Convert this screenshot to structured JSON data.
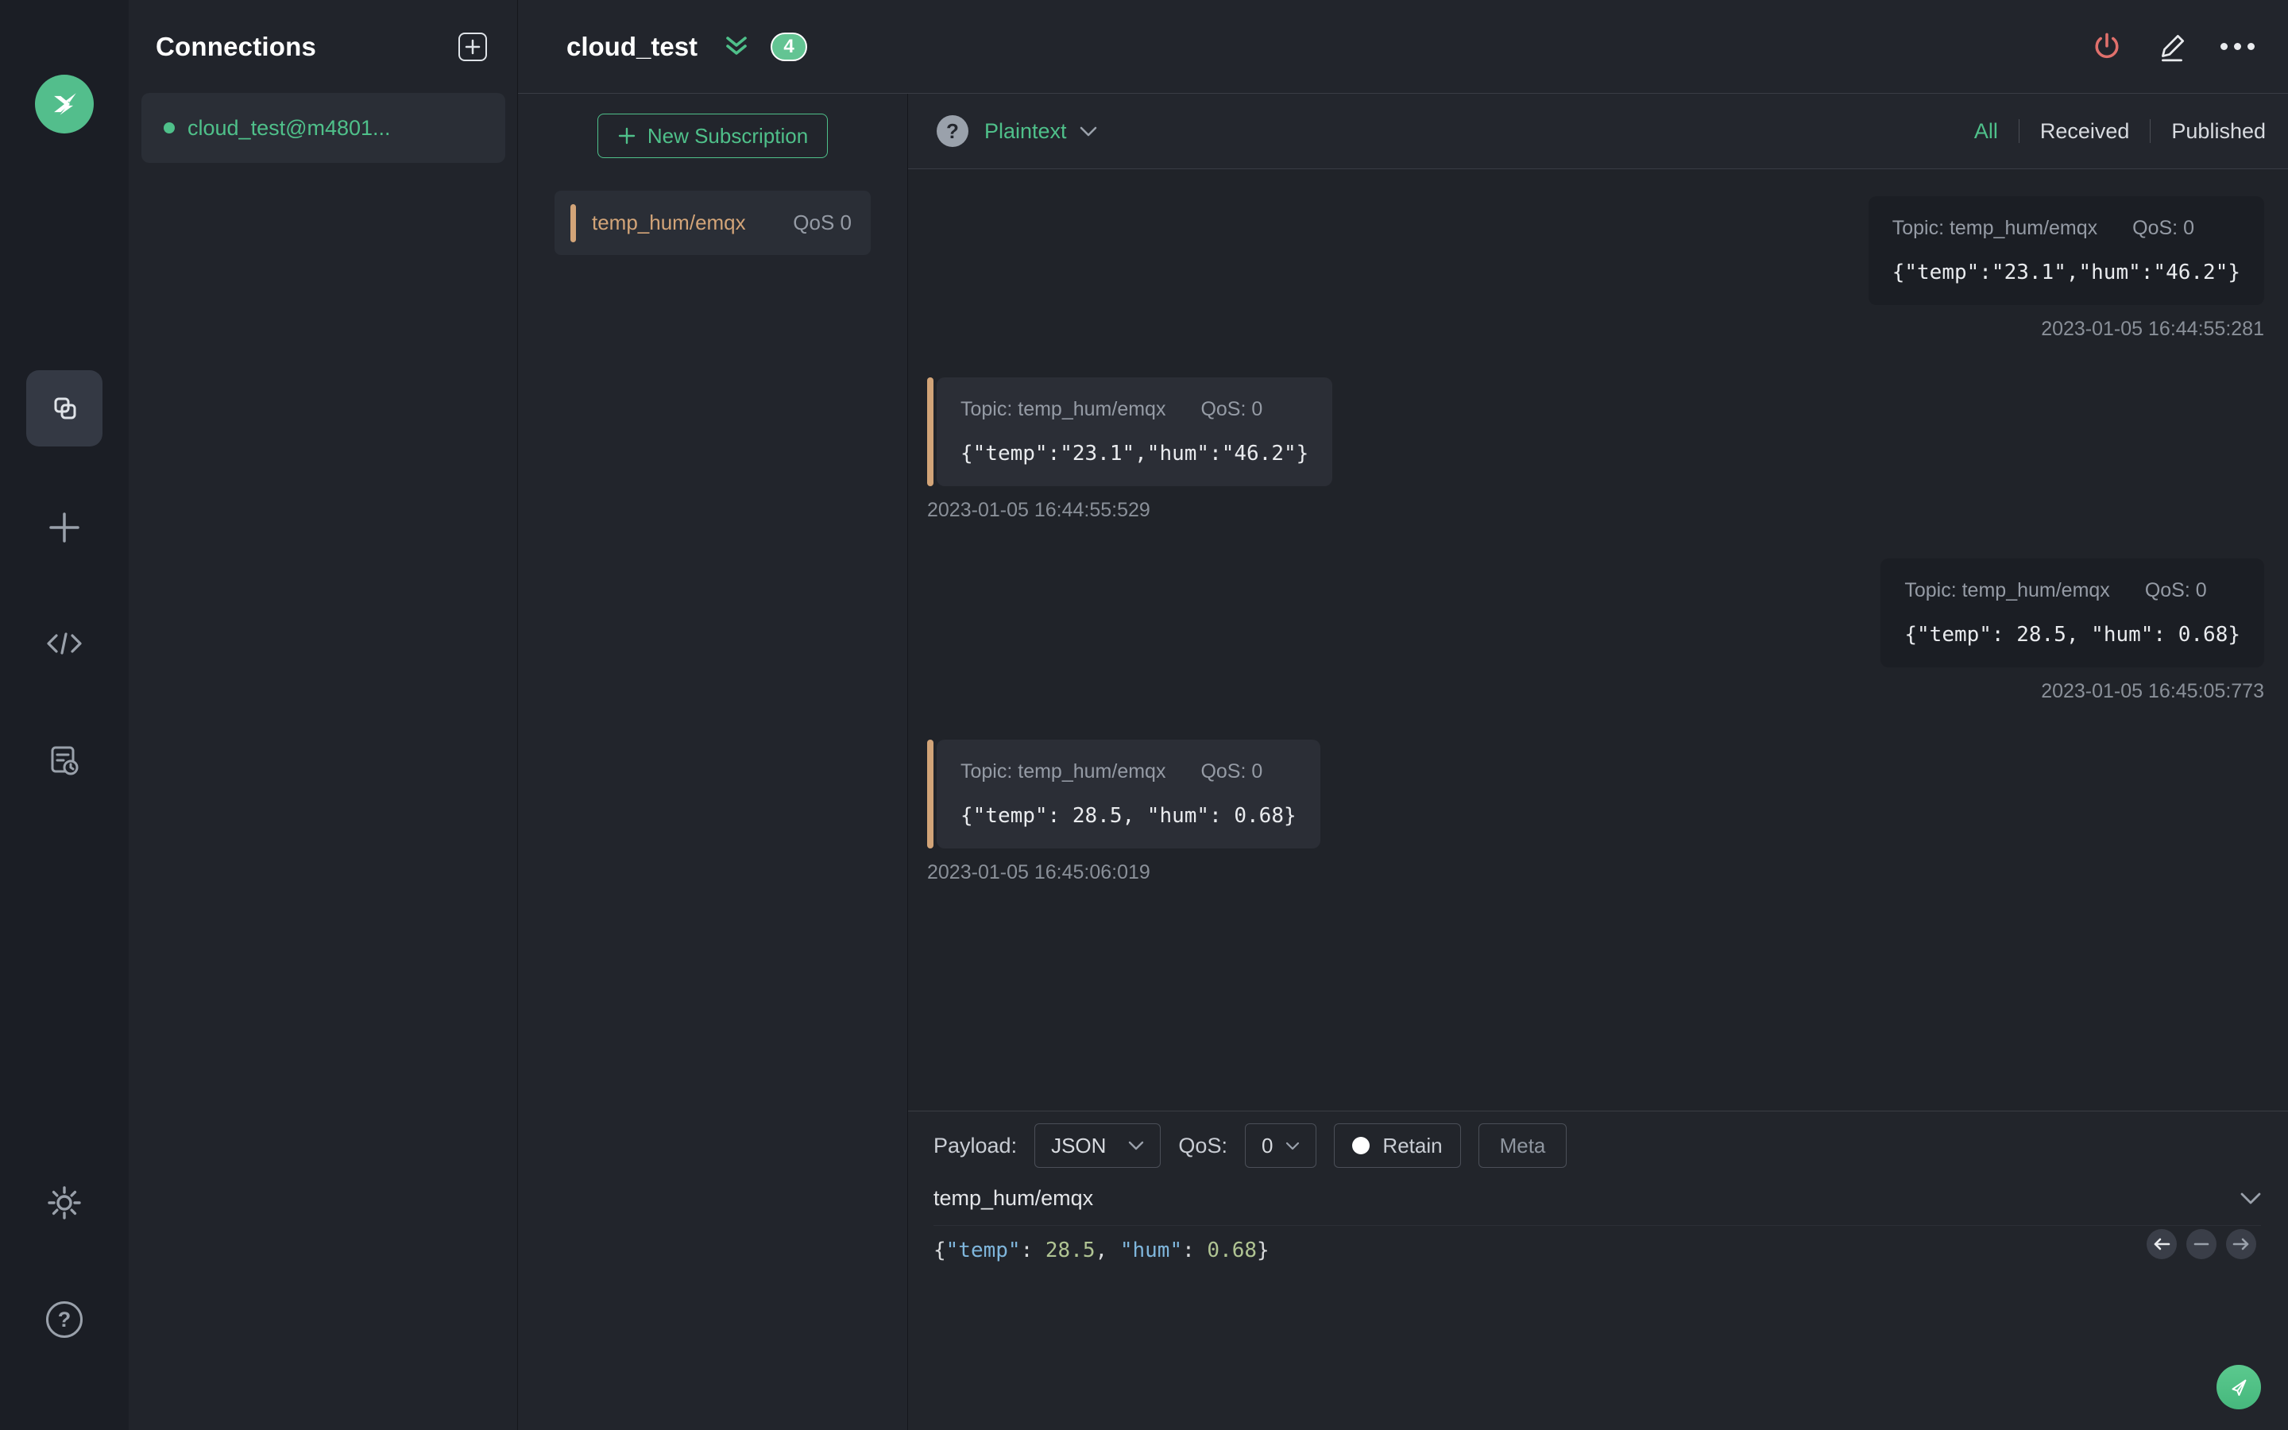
{
  "sidebar": {
    "icons": [
      "mqttx-logo",
      "connections-icon",
      "plus-icon",
      "code-icon",
      "log-icon",
      "gear-icon",
      "help-icon"
    ],
    "active_item": "connections",
    "help_glyph": "?"
  },
  "connections_panel": {
    "title": "Connections",
    "connections": [
      {
        "name": "cloud_test@m4801...",
        "connected": true
      }
    ]
  },
  "header": {
    "title": "cloud_test",
    "message_count_badge": "4"
  },
  "subscriptions": {
    "new_subscription_label": "New Subscription",
    "items": [
      {
        "topic": "temp_hum/emqx",
        "qos": "QoS 0",
        "color": "#d2a478"
      }
    ]
  },
  "message_toolbar": {
    "help_glyph": "?",
    "format": "Plaintext",
    "tabs": [
      "All",
      "Received",
      "Published"
    ],
    "active_tab": "All"
  },
  "messages": [
    {
      "direction": "published",
      "topic_label": "Topic: temp_hum/emqx",
      "qos_label": "QoS: 0",
      "payload": "{\"temp\":\"23.1\",\"hum\":\"46.2\"}",
      "timestamp": "2023-01-05 16:44:55:281"
    },
    {
      "direction": "received",
      "topic_label": "Topic: temp_hum/emqx",
      "qos_label": "QoS: 0",
      "payload": "{\"temp\":\"23.1\",\"hum\":\"46.2\"}",
      "timestamp": "2023-01-05 16:44:55:529"
    },
    {
      "direction": "published",
      "topic_label": "Topic: temp_hum/emqx",
      "qos_label": "QoS: 0",
      "payload": "{\"temp\": 28.5, \"hum\": 0.68}",
      "timestamp": "2023-01-05 16:45:05:773"
    },
    {
      "direction": "received",
      "topic_label": "Topic: temp_hum/emqx",
      "qos_label": "QoS: 0",
      "payload": "{\"temp\": 28.5, \"hum\": 0.68}",
      "timestamp": "2023-01-05 16:45:06:019"
    }
  ],
  "publish": {
    "payload_label": "Payload:",
    "format": "JSON",
    "qos_label": "QoS:",
    "qos": "0",
    "retain_label": "Retain",
    "meta_label": "Meta",
    "topic": "temp_hum/emqx",
    "payload_text": "{\"temp\": 28.5, \"hum\": 0.68}",
    "payload_tokens": [
      {
        "text": "{",
        "type": "punct"
      },
      {
        "text": "\"temp\"",
        "type": "key"
      },
      {
        "text": ": ",
        "type": "punct"
      },
      {
        "text": "28.5",
        "type": "number"
      },
      {
        "text": ", ",
        "type": "punct"
      },
      {
        "text": "\"hum\"",
        "type": "key"
      },
      {
        "text": ": ",
        "type": "punct"
      },
      {
        "text": "0.68",
        "type": "number"
      },
      {
        "text": "}",
        "type": "punct"
      }
    ]
  },
  "colors": {
    "accent_green": "#4fc08a",
    "disconnect_red": "#e0706c",
    "subscription_tan": "#d2a478",
    "editor_key_blue": "#7fb6dc",
    "editor_number_green": "#b0c493"
  }
}
